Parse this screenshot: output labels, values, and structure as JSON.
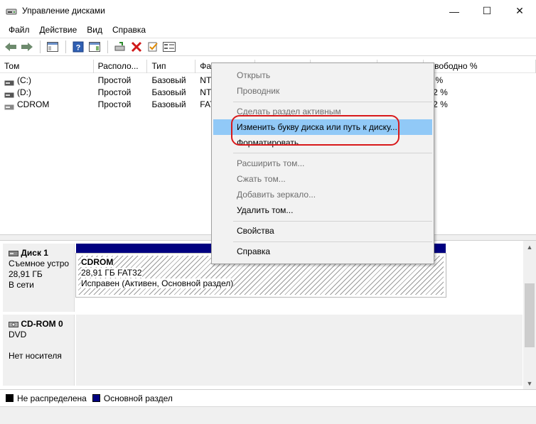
{
  "window": {
    "title": "Управление дисками",
    "min_glyph": "—",
    "max_glyph": "☐",
    "close_glyph": "✕"
  },
  "menu": [
    "Файл",
    "Действие",
    "Вид",
    "Справка"
  ],
  "columns": [
    "Том",
    "Располо...",
    "Тип",
    "Фа",
    "",
    "",
    "",
    "Свободно %"
  ],
  "volumes": [
    {
      "name": "(C:)",
      "layout": "Простой",
      "type": "Базовый",
      "fs": "NT",
      "free_pct": "5 %"
    },
    {
      "name": "(D:)",
      "layout": "Простой",
      "type": "Базовый",
      "fs": "NT",
      "free_pct": "92 %"
    },
    {
      "name": "CDROM",
      "layout": "Простой",
      "type": "Базовый",
      "fs": "FAT",
      "free_pct": "92 %"
    }
  ],
  "disks": [
    {
      "name": "Диск 1",
      "kind": "Съемное устро",
      "size": "28,91 ГБ",
      "state": "В сети",
      "volume": {
        "label": "CDROM",
        "size_fs": "28,91 ГБ FAT32",
        "status": "Исправен (Активен, Основной раздел)"
      }
    },
    {
      "name": "CD-ROM 0",
      "kind": "DVD",
      "state": "Нет носителя"
    }
  ],
  "legend": [
    {
      "label": "Не распределена",
      "color": "#000000"
    },
    {
      "label": "Основной раздел",
      "color": "#000080"
    }
  ],
  "context_menu": {
    "items": [
      {
        "label": "Открыть",
        "enabled": false
      },
      {
        "label": "Проводник",
        "enabled": false
      },
      {
        "label": "Сделать раздел активным",
        "enabled": false
      },
      {
        "label": "Изменить букву диска или путь к диску...",
        "enabled": true,
        "highlighted": true
      },
      {
        "label": "Форматировать...",
        "enabled": true
      },
      {
        "label": "Расширить том...",
        "enabled": false
      },
      {
        "label": "Сжать том...",
        "enabled": false
      },
      {
        "label": "Добавить зеркало...",
        "enabled": false
      },
      {
        "label": "Удалить том...",
        "enabled": true
      },
      {
        "label": "Свойства",
        "enabled": true
      },
      {
        "label": "Справка",
        "enabled": true
      }
    ]
  },
  "colors": {
    "accent_highlight": "#91c9f7",
    "primary_partition": "#000080",
    "annotation_ring": "#d8191b"
  }
}
